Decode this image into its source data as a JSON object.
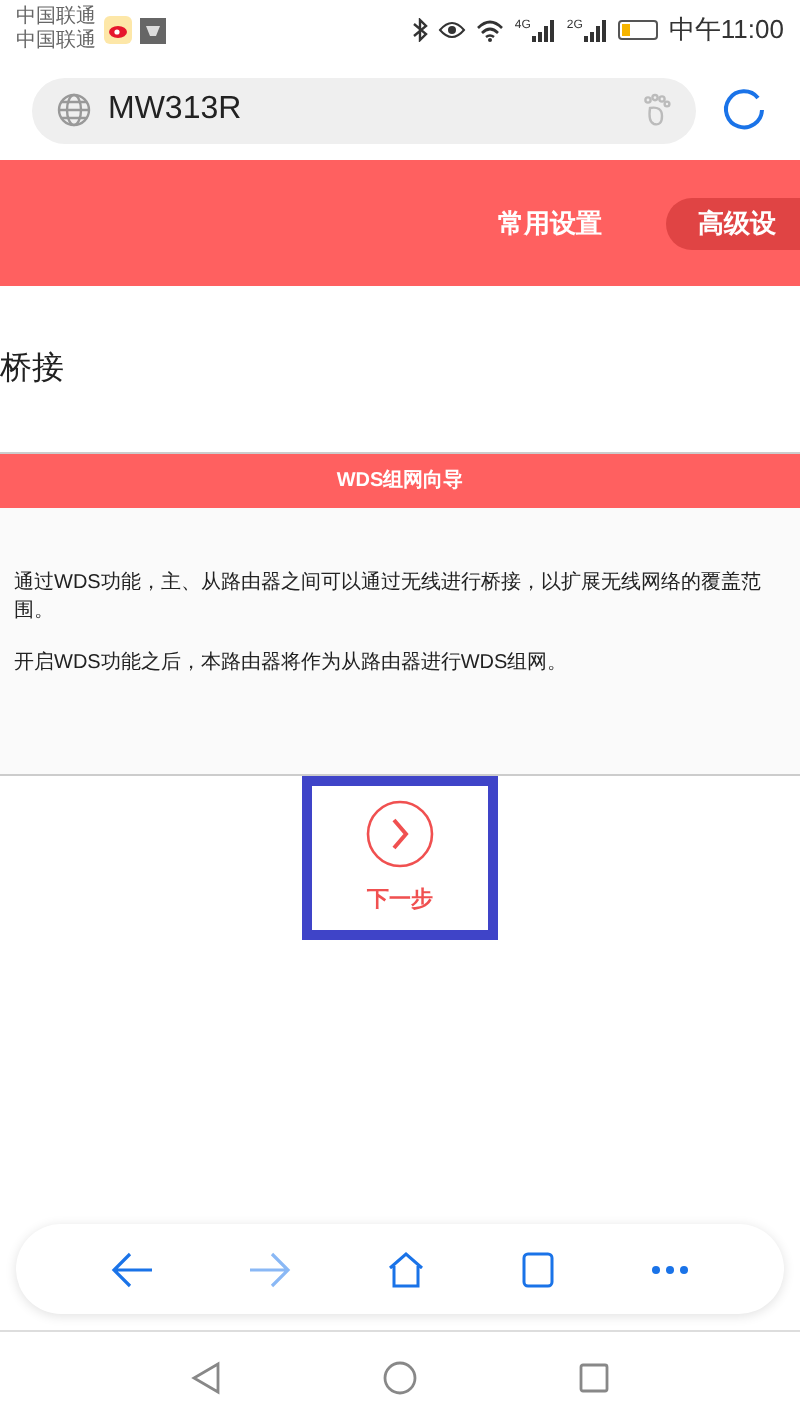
{
  "status_bar": {
    "carriers": [
      "中国联通",
      "中国联通"
    ],
    "network_labels": [
      "4G",
      "2G"
    ],
    "time": "中午11:00"
  },
  "address_bar": {
    "value": "MW313R"
  },
  "header": {
    "tabs": [
      {
        "label": "常用设置",
        "selected": false
      },
      {
        "label": "高级设",
        "selected": true
      }
    ]
  },
  "page_title": "桥接",
  "section": {
    "title": "WDS组网向导",
    "paragraphs": [
      "通过WDS功能，主、从路由器之间可以通过无线进行桥接，以扩展无线网络的覆盖范围。",
      "开启WDS功能之后，本路由器将作为从路由器进行WDS组网。"
    ]
  },
  "next_button": {
    "label": "下一步",
    "highlighted": true
  }
}
